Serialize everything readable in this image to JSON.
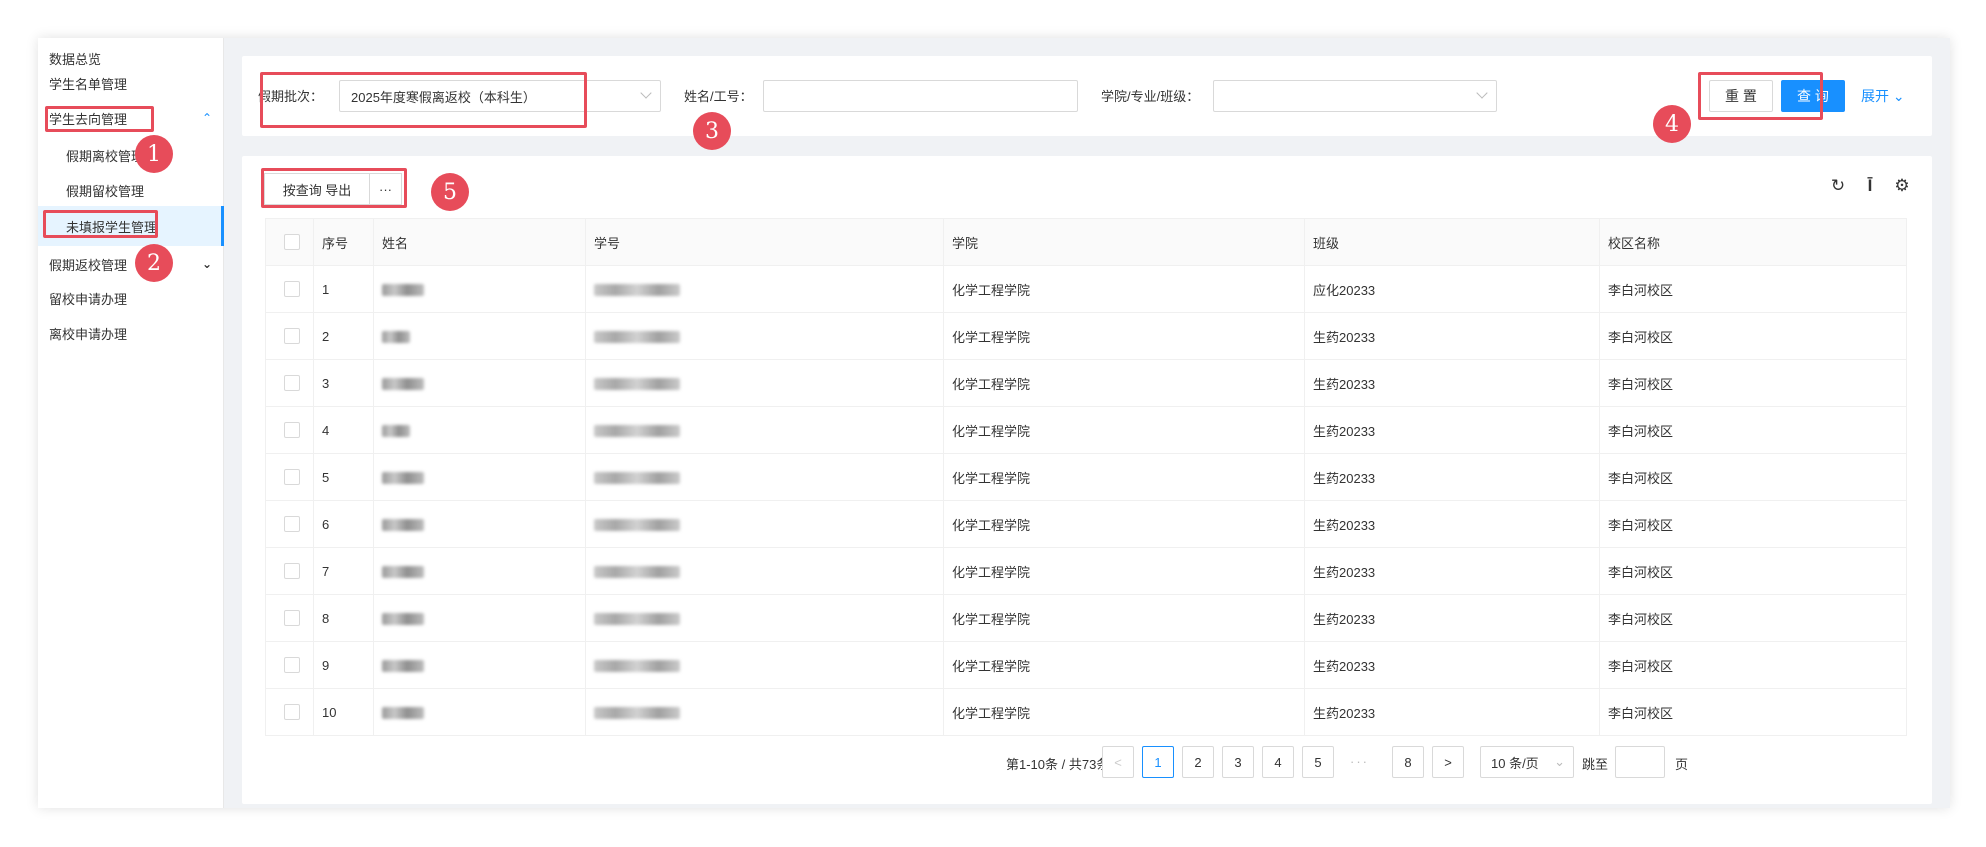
{
  "sidebar": {
    "items": [
      {
        "label": "数据总览"
      },
      {
        "label": "学生名单管理"
      },
      {
        "label": "学生去向管理"
      },
      {
        "label": "假期离校管理"
      },
      {
        "label": "假期留校管理"
      },
      {
        "label": "未填报学生管理"
      },
      {
        "label": "假期返校管理"
      },
      {
        "label": "留校申请办理"
      },
      {
        "label": "离校申请办理"
      }
    ]
  },
  "filter": {
    "batch_label": "假期批次：",
    "batch_value": "2025年度寒假离返校（本科生）",
    "name_label": "姓名/工号：",
    "name_value": "",
    "college_label": "学院/专业/班级：",
    "college_value": "",
    "reset_label": "重 置",
    "query_label": "查 询",
    "expand_label": "展开"
  },
  "toolbar": {
    "export_label": "按查询 导出",
    "more_label": "···",
    "refresh_icon": "refresh-icon",
    "density_icon": "column-height-icon",
    "settings_icon": "settings-icon"
  },
  "table": {
    "headers": [
      "序号",
      "姓名",
      "学号",
      "学院",
      "班级",
      "校区名称"
    ],
    "rows": [
      {
        "no": "1",
        "college": "化学工程学院",
        "class": "应化20233",
        "campus": "李白河校区"
      },
      {
        "no": "2",
        "college": "化学工程学院",
        "class": "生药20233",
        "campus": "李白河校区"
      },
      {
        "no": "3",
        "college": "化学工程学院",
        "class": "生药20233",
        "campus": "李白河校区"
      },
      {
        "no": "4",
        "college": "化学工程学院",
        "class": "生药20233",
        "campus": "李白河校区"
      },
      {
        "no": "5",
        "college": "化学工程学院",
        "class": "生药20233",
        "campus": "李白河校区"
      },
      {
        "no": "6",
        "college": "化学工程学院",
        "class": "生药20233",
        "campus": "李白河校区"
      },
      {
        "no": "7",
        "college": "化学工程学院",
        "class": "生药20233",
        "campus": "李白河校区"
      },
      {
        "no": "8",
        "college": "化学工程学院",
        "class": "生药20233",
        "campus": "李白河校区"
      },
      {
        "no": "9",
        "college": "化学工程学院",
        "class": "生药20233",
        "campus": "李白河校区"
      },
      {
        "no": "10",
        "college": "化学工程学院",
        "class": "生药20233",
        "campus": "李白河校区"
      }
    ]
  },
  "pagination": {
    "summary": "第1-10条 / 共73条",
    "prev": "<",
    "pages": [
      "1",
      "2",
      "3",
      "4",
      "5",
      "8"
    ],
    "ellipsis": "···",
    "next": ">",
    "page_size": "10 条/页",
    "jump_label": "跳至",
    "jump_suffix": "页"
  },
  "annotations": [
    "1",
    "2",
    "3",
    "4",
    "5"
  ],
  "colors": {
    "accent": "#1890ff",
    "annotation": "#e74c5a"
  }
}
